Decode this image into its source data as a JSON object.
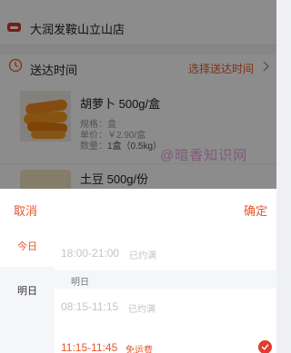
{
  "store": {
    "name": "大润发鞍山立山店",
    "logo_icon": "store-logo-icon"
  },
  "delivery": {
    "label": "送达时间",
    "action": "选择送达时间",
    "icon": "clock-icon"
  },
  "products": [
    {
      "name": "胡萝卜 500g/盒",
      "spec": "规格：盒",
      "price": "单价：￥2.90/盒",
      "quantity_label": "数量：",
      "quantity": "1盒（0.5kg）"
    },
    {
      "name": "土豆 500g/份"
    }
  ],
  "watermark": "@暗香知识网",
  "sheet": {
    "cancel": "取消",
    "confirm": "确定",
    "days": [
      "今日",
      "明日"
    ],
    "group_label": "明日",
    "slots": [
      {
        "time": "18:00-21:00",
        "tag": "已约满",
        "state": "full"
      },
      {
        "time": "08:15-11:15",
        "tag": "已约满",
        "state": "full"
      },
      {
        "time": "11:15-11:45",
        "tag": "免运费",
        "state": "selected"
      }
    ]
  },
  "colors": {
    "accent": "#e8562a",
    "check": "#e03c2f",
    "disabled": "#c4c4c4",
    "logo": "#d9362b"
  }
}
